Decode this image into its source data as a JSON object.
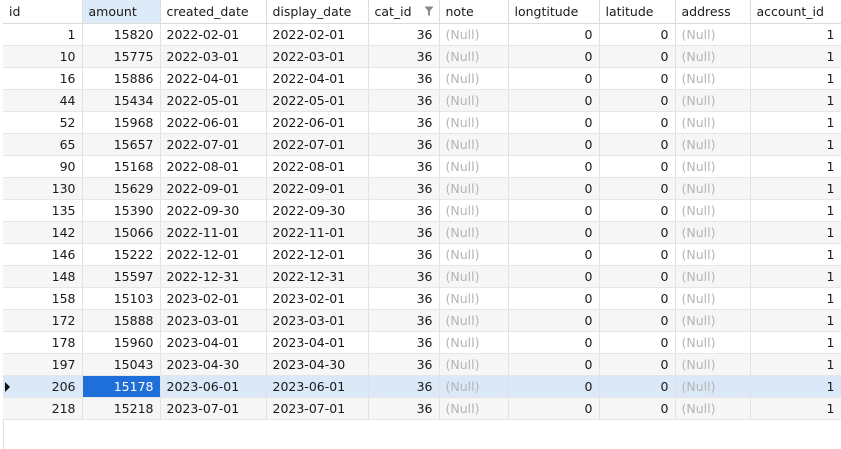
{
  "columns": [
    {
      "key": "id",
      "label": "id"
    },
    {
      "key": "amount",
      "label": "amount"
    },
    {
      "key": "created_date",
      "label": "created_date"
    },
    {
      "key": "display_date",
      "label": "display_date"
    },
    {
      "key": "cat_id",
      "label": "cat_id"
    },
    {
      "key": "note",
      "label": "note"
    },
    {
      "key": "longtitude",
      "label": "longtitude"
    },
    {
      "key": "latitude",
      "label": "latitude"
    },
    {
      "key": "address",
      "label": "address"
    },
    {
      "key": "account_id",
      "label": "account_id"
    }
  ],
  "active_column": "amount",
  "filter_column": "cat_id",
  "filter_icon": "funnel-icon",
  "row_marker_icon": "current-row-arrow-icon",
  "selected_row_index": 16,
  "selected_column": "amount",
  "colors": {
    "selection": "#1e6fd9",
    "current_row": "#dbe8f7",
    "active_header": "#ddeaf7",
    "null_text": "#b4b4b4"
  },
  "rows": [
    {
      "id": "1",
      "amount": "15820",
      "created_date": "2022-02-01",
      "display_date": "2022-02-01",
      "cat_id": "36",
      "note": "(Null)",
      "longtitude": "0",
      "latitude": "0",
      "address": "(Null)",
      "account_id": "1"
    },
    {
      "id": "10",
      "amount": "15775",
      "created_date": "2022-03-01",
      "display_date": "2022-03-01",
      "cat_id": "36",
      "note": "(Null)",
      "longtitude": "0",
      "latitude": "0",
      "address": "(Null)",
      "account_id": "1"
    },
    {
      "id": "16",
      "amount": "15886",
      "created_date": "2022-04-01",
      "display_date": "2022-04-01",
      "cat_id": "36",
      "note": "(Null)",
      "longtitude": "0",
      "latitude": "0",
      "address": "(Null)",
      "account_id": "1"
    },
    {
      "id": "44",
      "amount": "15434",
      "created_date": "2022-05-01",
      "display_date": "2022-05-01",
      "cat_id": "36",
      "note": "(Null)",
      "longtitude": "0",
      "latitude": "0",
      "address": "(Null)",
      "account_id": "1"
    },
    {
      "id": "52",
      "amount": "15968",
      "created_date": "2022-06-01",
      "display_date": "2022-06-01",
      "cat_id": "36",
      "note": "(Null)",
      "longtitude": "0",
      "latitude": "0",
      "address": "(Null)",
      "account_id": "1"
    },
    {
      "id": "65",
      "amount": "15657",
      "created_date": "2022-07-01",
      "display_date": "2022-07-01",
      "cat_id": "36",
      "note": "(Null)",
      "longtitude": "0",
      "latitude": "0",
      "address": "(Null)",
      "account_id": "1"
    },
    {
      "id": "90",
      "amount": "15168",
      "created_date": "2022-08-01",
      "display_date": "2022-08-01",
      "cat_id": "36",
      "note": "(Null)",
      "longtitude": "0",
      "latitude": "0",
      "address": "(Null)",
      "account_id": "1"
    },
    {
      "id": "130",
      "amount": "15629",
      "created_date": "2022-09-01",
      "display_date": "2022-09-01",
      "cat_id": "36",
      "note": "(Null)",
      "longtitude": "0",
      "latitude": "0",
      "address": "(Null)",
      "account_id": "1"
    },
    {
      "id": "135",
      "amount": "15390",
      "created_date": "2022-09-30",
      "display_date": "2022-09-30",
      "cat_id": "36",
      "note": "(Null)",
      "longtitude": "0",
      "latitude": "0",
      "address": "(Null)",
      "account_id": "1"
    },
    {
      "id": "142",
      "amount": "15066",
      "created_date": "2022-11-01",
      "display_date": "2022-11-01",
      "cat_id": "36",
      "note": "(Null)",
      "longtitude": "0",
      "latitude": "0",
      "address": "(Null)",
      "account_id": "1"
    },
    {
      "id": "146",
      "amount": "15222",
      "created_date": "2022-12-01",
      "display_date": "2022-12-01",
      "cat_id": "36",
      "note": "(Null)",
      "longtitude": "0",
      "latitude": "0",
      "address": "(Null)",
      "account_id": "1"
    },
    {
      "id": "148",
      "amount": "15597",
      "created_date": "2022-12-31",
      "display_date": "2022-12-31",
      "cat_id": "36",
      "note": "(Null)",
      "longtitude": "0",
      "latitude": "0",
      "address": "(Null)",
      "account_id": "1"
    },
    {
      "id": "158",
      "amount": "15103",
      "created_date": "2023-02-01",
      "display_date": "2023-02-01",
      "cat_id": "36",
      "note": "(Null)",
      "longtitude": "0",
      "latitude": "0",
      "address": "(Null)",
      "account_id": "1"
    },
    {
      "id": "172",
      "amount": "15888",
      "created_date": "2023-03-01",
      "display_date": "2023-03-01",
      "cat_id": "36",
      "note": "(Null)",
      "longtitude": "0",
      "latitude": "0",
      "address": "(Null)",
      "account_id": "1"
    },
    {
      "id": "178",
      "amount": "15960",
      "created_date": "2023-04-01",
      "display_date": "2023-04-01",
      "cat_id": "36",
      "note": "(Null)",
      "longtitude": "0",
      "latitude": "0",
      "address": "(Null)",
      "account_id": "1"
    },
    {
      "id": "197",
      "amount": "15043",
      "created_date": "2023-04-30",
      "display_date": "2023-04-30",
      "cat_id": "36",
      "note": "(Null)",
      "longtitude": "0",
      "latitude": "0",
      "address": "(Null)",
      "account_id": "1"
    },
    {
      "id": "206",
      "amount": "15178",
      "created_date": "2023-06-01",
      "display_date": "2023-06-01",
      "cat_id": "36",
      "note": "(Null)",
      "longtitude": "0",
      "latitude": "0",
      "address": "(Null)",
      "account_id": "1"
    },
    {
      "id": "218",
      "amount": "15218",
      "created_date": "2023-07-01",
      "display_date": "2023-07-01",
      "cat_id": "36",
      "note": "(Null)",
      "longtitude": "0",
      "latitude": "0",
      "address": "(Null)",
      "account_id": "1"
    }
  ]
}
